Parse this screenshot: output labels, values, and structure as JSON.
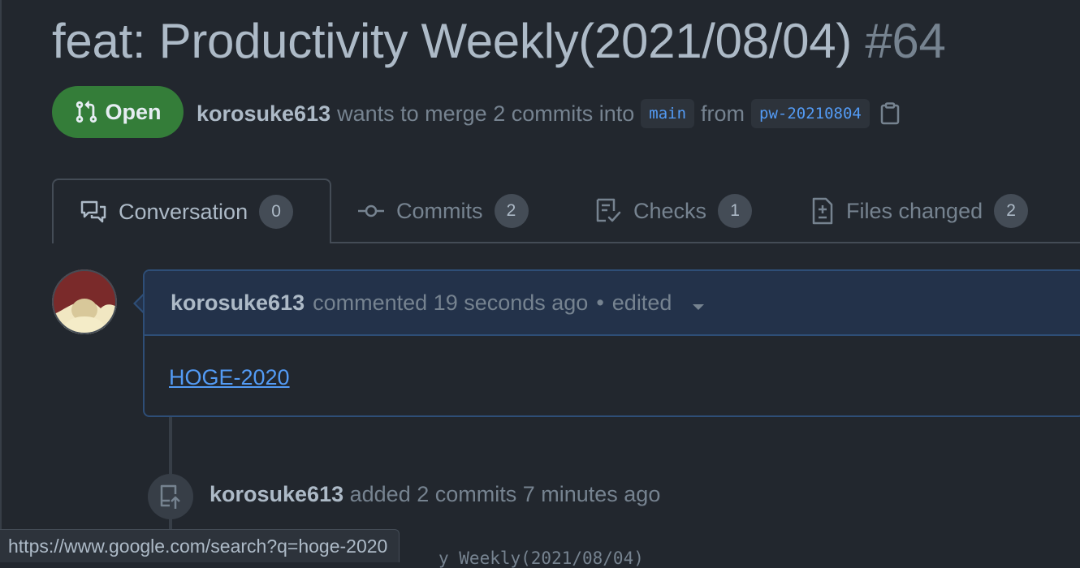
{
  "pr": {
    "title": "feat: Productivity Weekly(2021/08/04)",
    "number": "#64",
    "state": "Open",
    "author": "korosuke613",
    "merge_text": "wants to merge 2 commits into",
    "base_branch": "main",
    "from_text": "from",
    "head_branch": "pw-20210804"
  },
  "tabs": [
    {
      "label": "Conversation",
      "count": "0",
      "icon": "comment-discussion-icon"
    },
    {
      "label": "Commits",
      "count": "2",
      "icon": "git-commit-icon"
    },
    {
      "label": "Checks",
      "count": "1",
      "icon": "checklist-icon"
    },
    {
      "label": "Files changed",
      "count": "2",
      "icon": "file-diff-icon"
    }
  ],
  "comment": {
    "author": "korosuke613",
    "meta": "commented 19 seconds ago",
    "dot": "•",
    "edited": "edited",
    "body_link": "HOGE-2020"
  },
  "timeline_event": {
    "author": "korosuke613",
    "text": "added 2 commits 7 minutes ago",
    "icon": "repo-push-icon"
  },
  "commit_peek": "y Weekly(2021/08/04)",
  "status_url": "https://www.google.com/search?q=hoge-2020",
  "colors": {
    "background": "#22272e",
    "open_green": "#347d39",
    "link_blue": "#539bf5",
    "comment_header": "#23324a"
  }
}
